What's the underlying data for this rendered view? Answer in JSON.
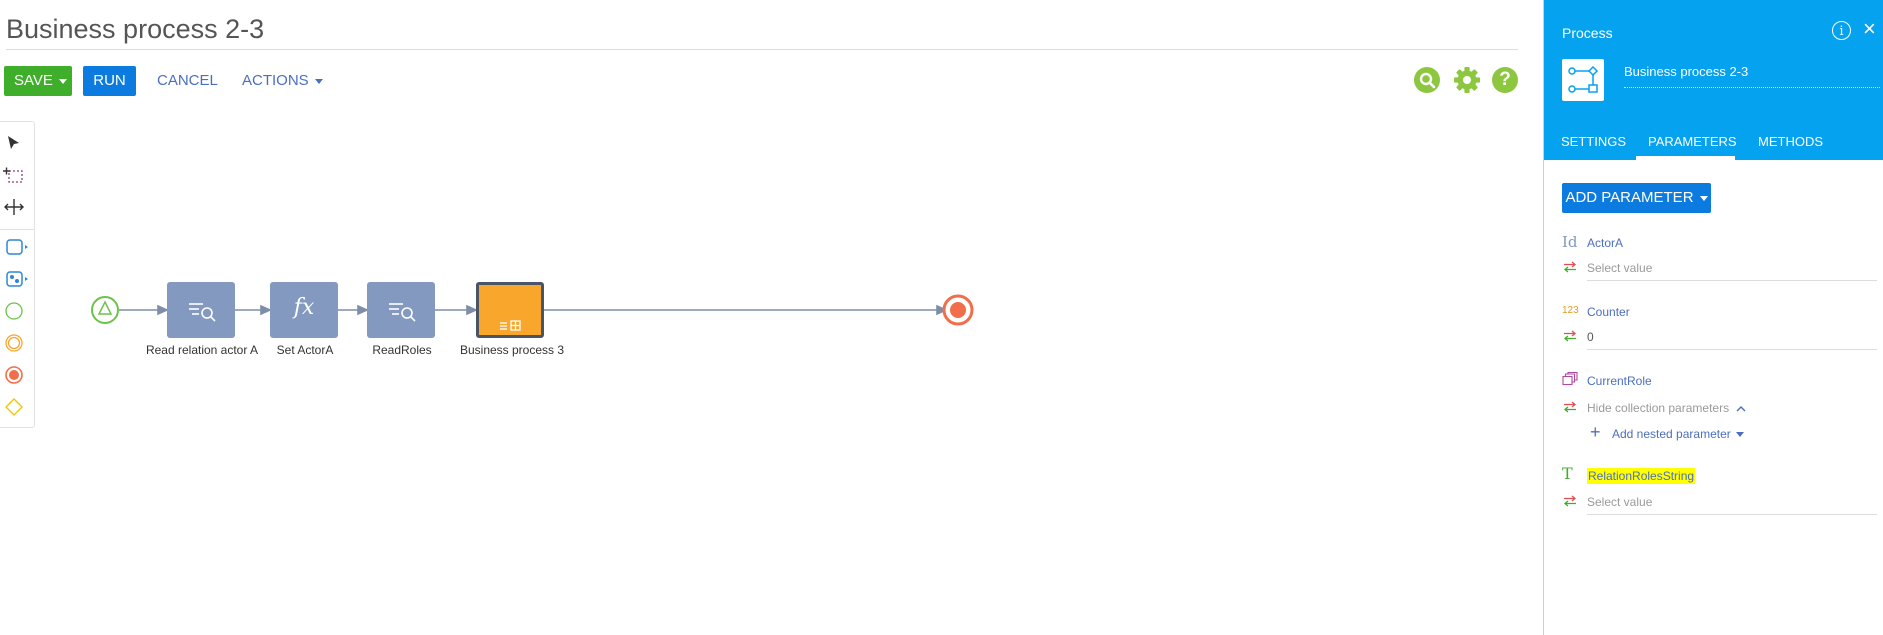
{
  "header": {
    "title": "Business process 2-3"
  },
  "toolbar": {
    "save_label": "SAVE",
    "run_label": "RUN",
    "cancel_label": "CANCEL",
    "actions_label": "ACTIONS",
    "help_label": "?"
  },
  "diagram": {
    "elements": [
      {
        "label": "Read relation actor A",
        "type": "read-data"
      },
      {
        "label": "Set ActorA",
        "type": "formula"
      },
      {
        "label": "ReadRoles",
        "type": "read-data"
      },
      {
        "label": "Business process 3",
        "type": "subprocess"
      }
    ],
    "formula_glyph": "fx"
  },
  "panel": {
    "title": "Process",
    "info_glyph": "i",
    "close_glyph": "×",
    "process_name": "Business process 2-3",
    "tabs": [
      "SETTINGS",
      "PARAMETERS",
      "METHODS"
    ],
    "active_tab": "PARAMETERS",
    "add_parameter_label": "ADD PARAMETER",
    "parameters": [
      {
        "type_glyph": "Id",
        "name": "ActorA",
        "value": "Select value"
      },
      {
        "type_glyph": "123",
        "name": "Counter",
        "value": "0"
      },
      {
        "type_glyph": "collection",
        "name": "CurrentRole",
        "value": "Hide collection parameters",
        "nested_label": "Add nested parameter"
      },
      {
        "type_glyph": "T",
        "name": "RelationRolesString",
        "value": "Select value"
      }
    ]
  },
  "colors": {
    "save": "#3fae2a",
    "primary": "#0c7be0",
    "panel_header": "#05a2f0",
    "node": "#8399c0",
    "subprocess": "#f8a62c",
    "end_event": "#f26d4a",
    "start_event": "#6cc24a",
    "highlight": "#ffff00",
    "toolbar_icons": "#8dc63f"
  }
}
